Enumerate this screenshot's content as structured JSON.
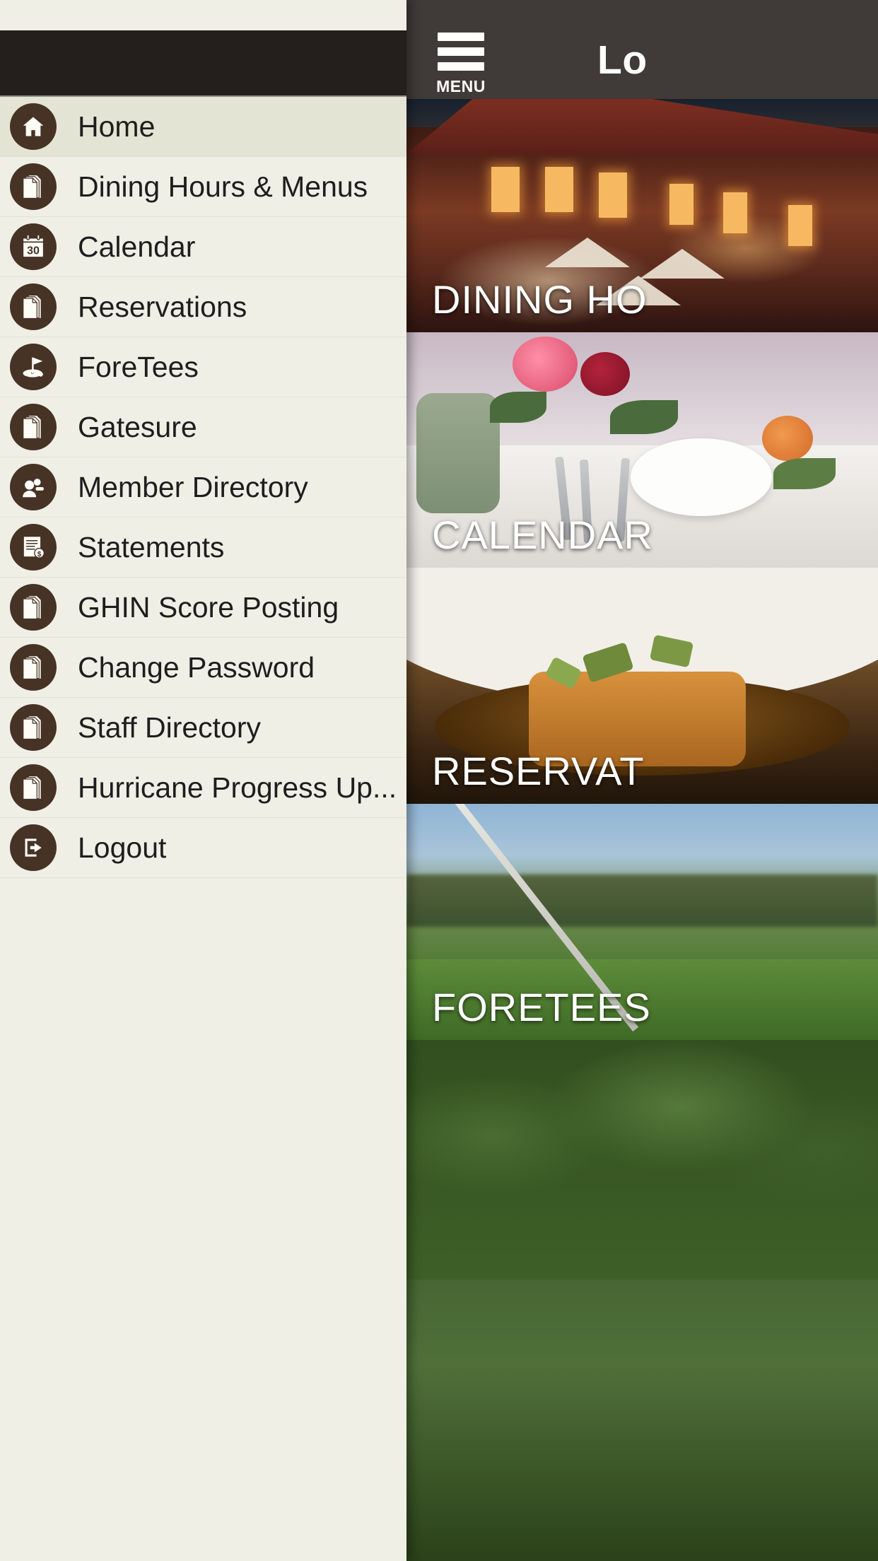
{
  "app": {
    "menu_button_label": "MENU",
    "title": "Lo",
    "hamburger_icon": "hamburger-icon"
  },
  "colors": {
    "drawer_background": "#efefe6",
    "drawer_header": "#241e1c",
    "icon_circle": "#463325",
    "active_row": "#e4e4d4",
    "app_bar": "#403a38",
    "divider": "#e2e2d6",
    "label_text": "#1e1e1e"
  },
  "sidebar": {
    "items": [
      {
        "label": "Home",
        "icon": "home-icon",
        "active": true
      },
      {
        "label": "Dining Hours & Menus",
        "icon": "document-icon",
        "active": false
      },
      {
        "label": "Calendar",
        "icon": "calendar-icon",
        "active": false,
        "calendar_day": "30"
      },
      {
        "label": "Reservations",
        "icon": "document-icon",
        "active": false
      },
      {
        "label": "ForeTees",
        "icon": "golf-flag-icon",
        "active": false
      },
      {
        "label": "Gatesure",
        "icon": "document-icon",
        "active": false
      },
      {
        "label": "Member Directory",
        "icon": "people-icon",
        "active": false
      },
      {
        "label": "Statements",
        "icon": "invoice-icon",
        "active": false
      },
      {
        "label": "GHIN Score Posting",
        "icon": "document-icon",
        "active": false
      },
      {
        "label": "Change Password",
        "icon": "document-icon",
        "active": false
      },
      {
        "label": "Staff Directory",
        "icon": "document-icon",
        "active": false
      },
      {
        "label": "Hurricane Progress Up...",
        "icon": "document-icon",
        "active": false
      },
      {
        "label": "Logout",
        "icon": "logout-icon",
        "active": false
      }
    ]
  },
  "content": {
    "tiles": [
      {
        "caption": "DINING HO",
        "image": "dining-hall-photo"
      },
      {
        "caption": "CALENDAR",
        "image": "table-setting-photo"
      },
      {
        "caption": "RESERVAT",
        "image": "entree-plate-photo"
      },
      {
        "caption": "FORETEES",
        "image": "golf-course-photo"
      },
      {
        "caption": "",
        "image": "trees-photo"
      }
    ]
  }
}
